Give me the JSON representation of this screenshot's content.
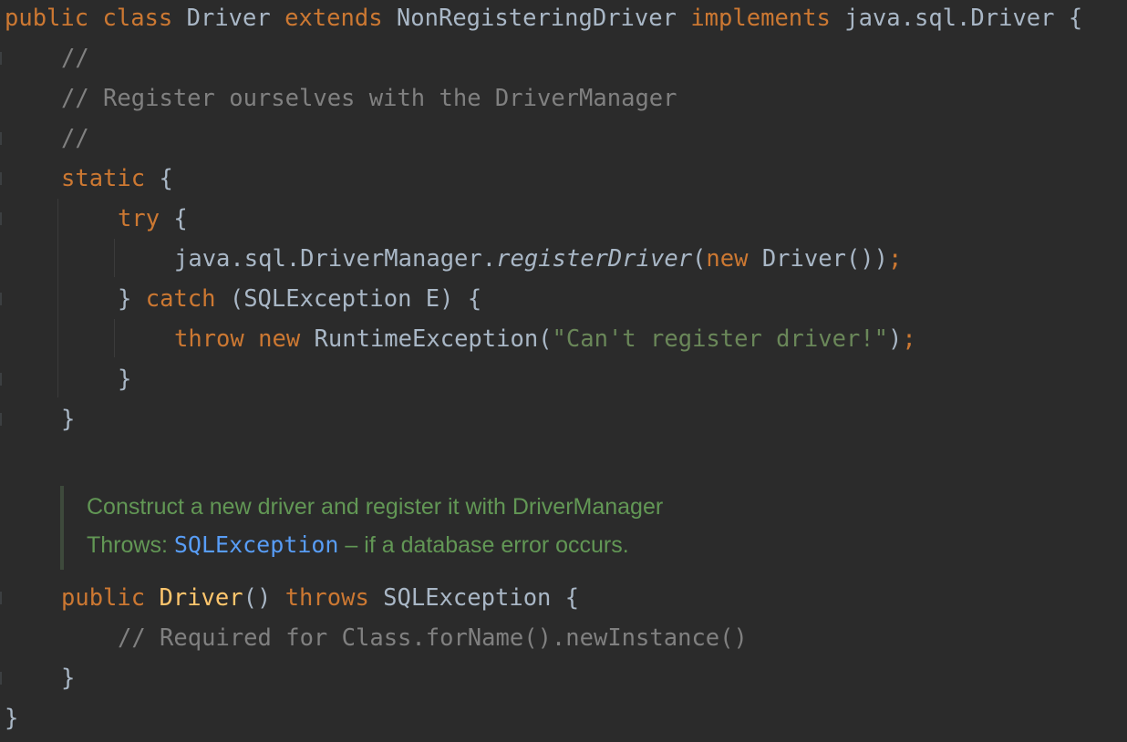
{
  "code": {
    "line1": {
      "public": "public",
      "class": "class",
      "name": "Driver",
      "extends": "extends",
      "parent": "NonRegisteringDriver",
      "implements": "implements",
      "iface": "java.sql.Driver",
      "brace": "{"
    },
    "line2": "//",
    "line3": "// Register ourselves with the DriverManager",
    "line4": "//",
    "line5": {
      "static": "static",
      "brace": "{"
    },
    "line6": {
      "try": "try",
      "brace": "{"
    },
    "line7": {
      "prefix": "java.sql.DriverManager.",
      "method": "registerDriver",
      "open": "(",
      "new": "new",
      "ctor": "Driver())",
      "semi": ";"
    },
    "line8": {
      "close": "}",
      "catch": "catch",
      "params": "(SQLException E) {"
    },
    "line9": {
      "throw": "throw",
      "new": "new",
      "cls": "RuntimeException(",
      "str": "\"Can't register driver!\"",
      "close": ")",
      "semi": ";"
    },
    "line10": "}",
    "line11": "}",
    "doc": {
      "description": "Construct a new driver and register it with DriverManager",
      "throws_label": "Throws: ",
      "throws_type": "SQLException",
      "throws_desc": " – if a database error occurs."
    },
    "line12": {
      "public": "public",
      "name": "Driver",
      "parens": "()",
      "throws": "throws",
      "exc": "SQLException",
      "brace": "{"
    },
    "line13": "// Required for Class.forName().newInstance()",
    "line14": "}",
    "line15": "}"
  }
}
